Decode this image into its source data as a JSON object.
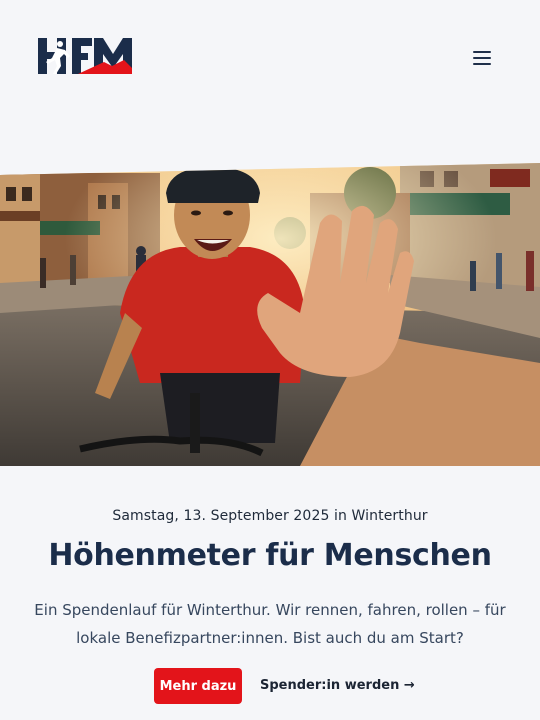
{
  "header": {
    "logo_alt": "HfM Logo",
    "menu_icon": "hamburger-icon"
  },
  "hero": {
    "image_alt": "Smiling cyclist in red jersey high-fiving a spectator on a small-town street"
  },
  "main": {
    "date_line": "Samstag, 13. September 2025 in Winterthur",
    "title": "Höhenmeter für Menschen",
    "intro": "Ein Spendenlauf für Winterthur. Wir rennen, fahren, rollen – für lokale Benefizpartner:innen. Bist auch du am Start?",
    "cta_primary": "Mehr dazu",
    "cta_secondary": "Spender:in werden →"
  },
  "colors": {
    "brand_navy": "#1b2d4a",
    "accent_red": "#e3141a",
    "background": "#f5f6f9"
  }
}
